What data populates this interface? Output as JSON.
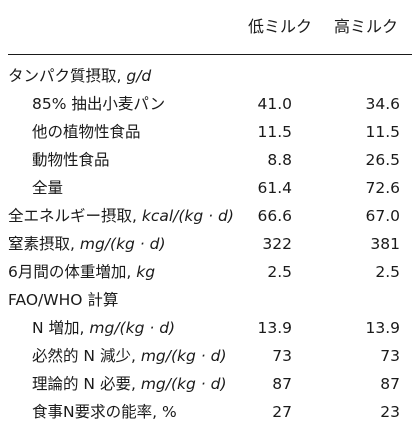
{
  "columns": {
    "low_milk": "低ミルク",
    "high_milk": "高ミルク"
  },
  "rows": [
    {
      "label": "タンパク質摂取, ",
      "unit": "g/d",
      "low": "",
      "high": ""
    },
    {
      "label": "85% 抽出小麦パン",
      "unit": "",
      "low": "41.0",
      "high": "34.6"
    },
    {
      "label": "他の植物性食品",
      "unit": "",
      "low": "11.5",
      "high": "11.5"
    },
    {
      "label": "動物性食品",
      "unit": "",
      "low": "8.8",
      "high": "26.5"
    },
    {
      "label": "全量",
      "unit": "",
      "low": "61.4",
      "high": "72.6"
    },
    {
      "label": "全エネルギー摂取, ",
      "unit": "kcal/(kg · d)",
      "low": "66.6",
      "high": "67.0"
    },
    {
      "label": "窒素摂取, ",
      "unit": "mg/(kg · d)",
      "low": "322",
      "high": "381"
    },
    {
      "label": "6月間の体重増加, ",
      "unit": "kg",
      "low": "2.5",
      "high": "2.5"
    },
    {
      "label": "FAO/WHO 計算",
      "unit": "",
      "low": "",
      "high": ""
    },
    {
      "label": "N 増加, ",
      "unit": "mg/(kg · d)",
      "low": "13.9",
      "high": "13.9"
    },
    {
      "label": "必然的 N 減少, ",
      "unit": "mg/(kg · d)",
      "low": "73",
      "high": "73"
    },
    {
      "label": "理論的 N 必要, ",
      "unit": "mg/(kg · d)",
      "low": "87",
      "high": "87"
    },
    {
      "label": "食事N要求の能率, %",
      "unit": "",
      "low": "27",
      "high": "23"
    }
  ]
}
